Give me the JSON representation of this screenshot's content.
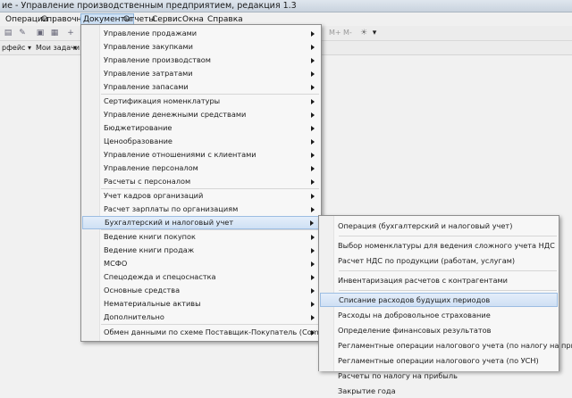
{
  "window": {
    "title": "ие - Управление производственным предприятием, редакция 1.3"
  },
  "menubar": [
    "Операции",
    "Справочники",
    "Документы",
    "Отчеты",
    "Сервис",
    "Окна",
    "Справка"
  ],
  "toolbar": {
    "mplus": "M+",
    "mminus": "M-"
  },
  "panelbar": {
    "interface": "рфейс ▾",
    "tasks": "Мои задачи"
  },
  "documents_menu": [
    {
      "label": "Управление продажами",
      "submenu": true
    },
    {
      "label": "Управление закупками",
      "submenu": true
    },
    {
      "label": "Управление производством",
      "submenu": true
    },
    {
      "label": "Управление затратами",
      "submenu": true
    },
    {
      "label": "Управление запасами",
      "submenu": true
    },
    {
      "label": "Сертификация номенклатуры",
      "submenu": true
    },
    {
      "label": "Управление денежными средствами",
      "submenu": true
    },
    {
      "label": "Бюджетирование",
      "submenu": true
    },
    {
      "label": "Ценообразование",
      "submenu": true
    },
    {
      "label": "Управление отношениями с клиентами",
      "submenu": true
    },
    {
      "label": "Управление персоналом",
      "submenu": true
    },
    {
      "label": "Расчеты с персоналом",
      "submenu": true
    },
    {
      "label": "Учет кадров организаций",
      "submenu": true
    },
    {
      "label": "Расчет зарплаты по организациям",
      "submenu": true
    },
    {
      "label": "Бухгалтерский и налоговый учет",
      "submenu": true,
      "highlighted": true
    },
    {
      "label": "Ведение книги покупок",
      "submenu": true
    },
    {
      "label": "Ведение книги продаж",
      "submenu": true
    },
    {
      "label": "МСФО",
      "submenu": true
    },
    {
      "label": "Спецодежда и спецоснастка",
      "submenu": true
    },
    {
      "label": "Основные средства",
      "submenu": true
    },
    {
      "label": "Нематериальные активы",
      "submenu": true
    },
    {
      "label": "Дополнительно",
      "submenu": true
    },
    {
      "label": "Обмен данными по схеме Поставщик-Покупатель (CommerceML)",
      "submenu": true
    }
  ],
  "accounting_submenu": [
    {
      "label": "Операция (бухгалтерский и налоговый учет)"
    },
    {
      "label": "Выбор номенклатуры для ведения сложного учета НДС"
    },
    {
      "label": "Расчет НДС по продукции (работам, услугам)"
    },
    {
      "label": "Инвентаризация расчетов с контрагентами"
    },
    {
      "label": "Списание расходов будущих периодов",
      "highlighted": true
    },
    {
      "label": "Расходы на добровольное страхование"
    },
    {
      "label": "Определение финансовых результатов"
    },
    {
      "label": "Регламентные операции налогового учета (по налогу на прибыль)"
    },
    {
      "label": "Регламентные операции налогового учета (по УСН)"
    },
    {
      "label": "Расчеты по налогу на прибыль"
    },
    {
      "label": "Закрытие года"
    }
  ]
}
